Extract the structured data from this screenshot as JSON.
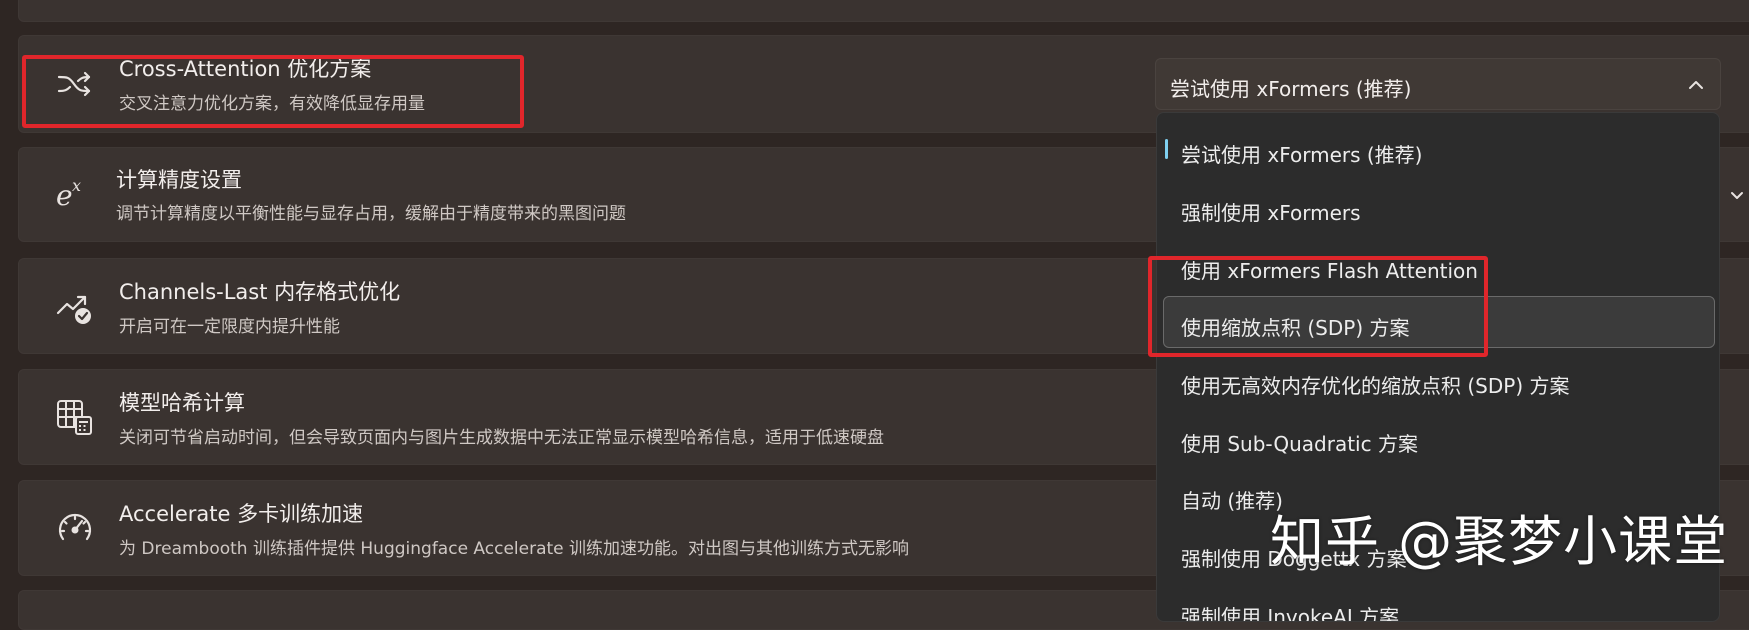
{
  "settings": [
    {
      "icon": "shuffle-icon",
      "title": "Cross-Attention 优化方案",
      "description": "交叉注意力优化方案，有效降低显存用量"
    },
    {
      "icon": "exponent-icon",
      "title": "计算精度设置",
      "description": "调节计算精度以平衡性能与显存占用，缓解由于精度带来的黑图问题"
    },
    {
      "icon": "trend-check-icon",
      "title": "Channels-Last 内存格式优化",
      "description": "开启可在一定限度内提升性能"
    },
    {
      "icon": "table-calculator-icon",
      "title": "模型哈希计算",
      "description": "关闭可节省启动时间，但会导致页面内与图片生成数据中无法正常显示模型哈希信息，适用于低速硬盘"
    },
    {
      "icon": "gauge-icon",
      "title": "Accelerate 多卡训练加速",
      "description": "为 Dreambooth 训练插件提供 Huggingface Accelerate 训练加速功能。对出图与其他训练方式无影响"
    }
  ],
  "combo": {
    "selected": "尝试使用 xFormers (推荐)"
  },
  "dropdown": {
    "options": [
      "尝试使用 xFormers (推荐)",
      "强制使用 xFormers",
      "使用 xFormers Flash Attention",
      "使用缩放点积 (SDP) 方案",
      "使用无高效内存优化的缩放点积 (SDP) 方案",
      "使用 Sub-Quadratic 方案",
      "自动 (推荐)",
      "强制使用 Doggettx 方案",
      "强制使用 InvokeAI 方案"
    ]
  },
  "watermark": {
    "text": "知乎 @聚梦小课堂"
  },
  "colors": {
    "highlight_red": "#e0262b",
    "selection_accent": "#7fd0f0",
    "background": "#2e2623",
    "card": "#3a3330"
  }
}
